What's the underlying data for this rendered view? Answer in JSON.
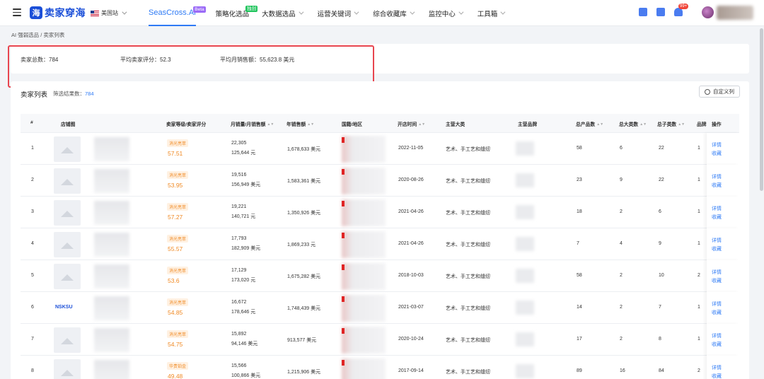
{
  "nav": {
    "logo_text": "卖家穿海",
    "site": "美国站",
    "items": [
      {
        "label": "SeasCross.Ai",
        "sup": "Beta"
      },
      {
        "label": "策略化选品",
        "sup": "独创"
      },
      {
        "label": "大数据选品"
      },
      {
        "label": "运营关键词"
      },
      {
        "label": "综合收藏库"
      },
      {
        "label": "监控中心"
      },
      {
        "label": "工具箱"
      }
    ],
    "notif_badge": "99+"
  },
  "breadcrumb": "AI 强弱选品 / 卖家列表",
  "stats": {
    "total": "卖家总数：784",
    "avg_score": "平均卖家评分：52.3",
    "avg_sales": "平均月销售额：55,623.8 美元"
  },
  "list": {
    "title": "卖家列表",
    "filter_label": "筛选结果数：",
    "filter_count": "784",
    "custom_btn": "自定义列",
    "headers": [
      "#",
      "店铺图",
      "卖家等级/卖家评分",
      "月销量/月销售额",
      "年销售额",
      "国籍/地区",
      "开店时间",
      "主营大类",
      "主营品牌",
      "总产品数",
      "总大类数",
      "总子类数",
      "品牌",
      "操作"
    ],
    "rows": [
      {
        "idx": "1",
        "grade": "消光亮萃",
        "score": "57.51",
        "msales": "22,305",
        "mrev": "125,644 元",
        "yrev": "1,678,633 美元",
        "open": "2022-11-05",
        "cat": "艺术、手工艺和缝纫",
        "products": "58",
        "bigcat": "6",
        "subcat": "22",
        "brand": "1",
        "op1": "详情",
        "op2": "收藏"
      },
      {
        "idx": "2",
        "grade": "消光亮萃",
        "score": "53.95",
        "msales": "19,516",
        "mrev": "156,949 美元",
        "yrev": "1,583,361 美元",
        "open": "2020-08-26",
        "cat": "艺术、手工艺和缝纫",
        "products": "23",
        "bigcat": "9",
        "subcat": "22",
        "brand": "1",
        "op1": "详情",
        "op2": "收藏"
      },
      {
        "idx": "3",
        "grade": "消光亮萃",
        "score": "57.27",
        "msales": "19,221",
        "mrev": "140,721 元",
        "yrev": "1,350,926 美元",
        "open": "2021-04-26",
        "cat": "艺术、手工艺和缝纫",
        "products": "18",
        "bigcat": "2",
        "subcat": "6",
        "brand": "1",
        "op1": "详情",
        "op2": "收藏"
      },
      {
        "idx": "4",
        "grade": "消光亮萃",
        "score": "55.57",
        "msales": "17,793",
        "mrev": "182,909 美元",
        "yrev": "1,869,233 元",
        "open": "2021-04-26",
        "cat": "艺术、手工艺和缝纫",
        "products": "7",
        "bigcat": "4",
        "subcat": "9",
        "brand": "1",
        "op1": "详情",
        "op2": "收藏"
      },
      {
        "idx": "5",
        "grade": "消光亮萃",
        "score": "53.6",
        "msales": "17,129",
        "mrev": "173,020 元",
        "yrev": "1,675,282 美元",
        "open": "2018-10-03",
        "cat": "艺术、手工艺和缝纫",
        "products": "58",
        "bigcat": "2",
        "subcat": "10",
        "brand": "2",
        "op1": "详情",
        "op2": "收藏"
      },
      {
        "idx": "6",
        "grade": "消光亮萃",
        "score": "54.85",
        "msales": "16,672",
        "mrev": "178,646 元",
        "yrev": "1,748,439 美元",
        "open": "2021-03-07",
        "cat": "艺术、手工艺和缝纫",
        "products": "14",
        "bigcat": "2",
        "subcat": "7",
        "brand": "1",
        "op1": "详情",
        "op2": "收藏",
        "logo": "NSKSU"
      },
      {
        "idx": "7",
        "grade": "消光亮萃",
        "score": "54.75",
        "msales": "15,892",
        "mrev": "94,146 美元",
        "yrev": "913,577 美元",
        "open": "2020-10-24",
        "cat": "艺术、手工艺和缝纫",
        "products": "17",
        "bigcat": "2",
        "subcat": "8",
        "brand": "1",
        "op1": "详情",
        "op2": "收藏"
      },
      {
        "idx": "8",
        "grade": "华贵铂金",
        "score": "49.48",
        "msales": "15,566",
        "mrev": "100,866 美元",
        "yrev": "1,215,906 美元",
        "open": "2017-09-14",
        "cat": "艺术、手工艺和缝纫",
        "products": "89",
        "bigcat": "16",
        "subcat": "84",
        "brand": "2",
        "op1": "详情",
        "op2": "收藏"
      }
    ]
  }
}
